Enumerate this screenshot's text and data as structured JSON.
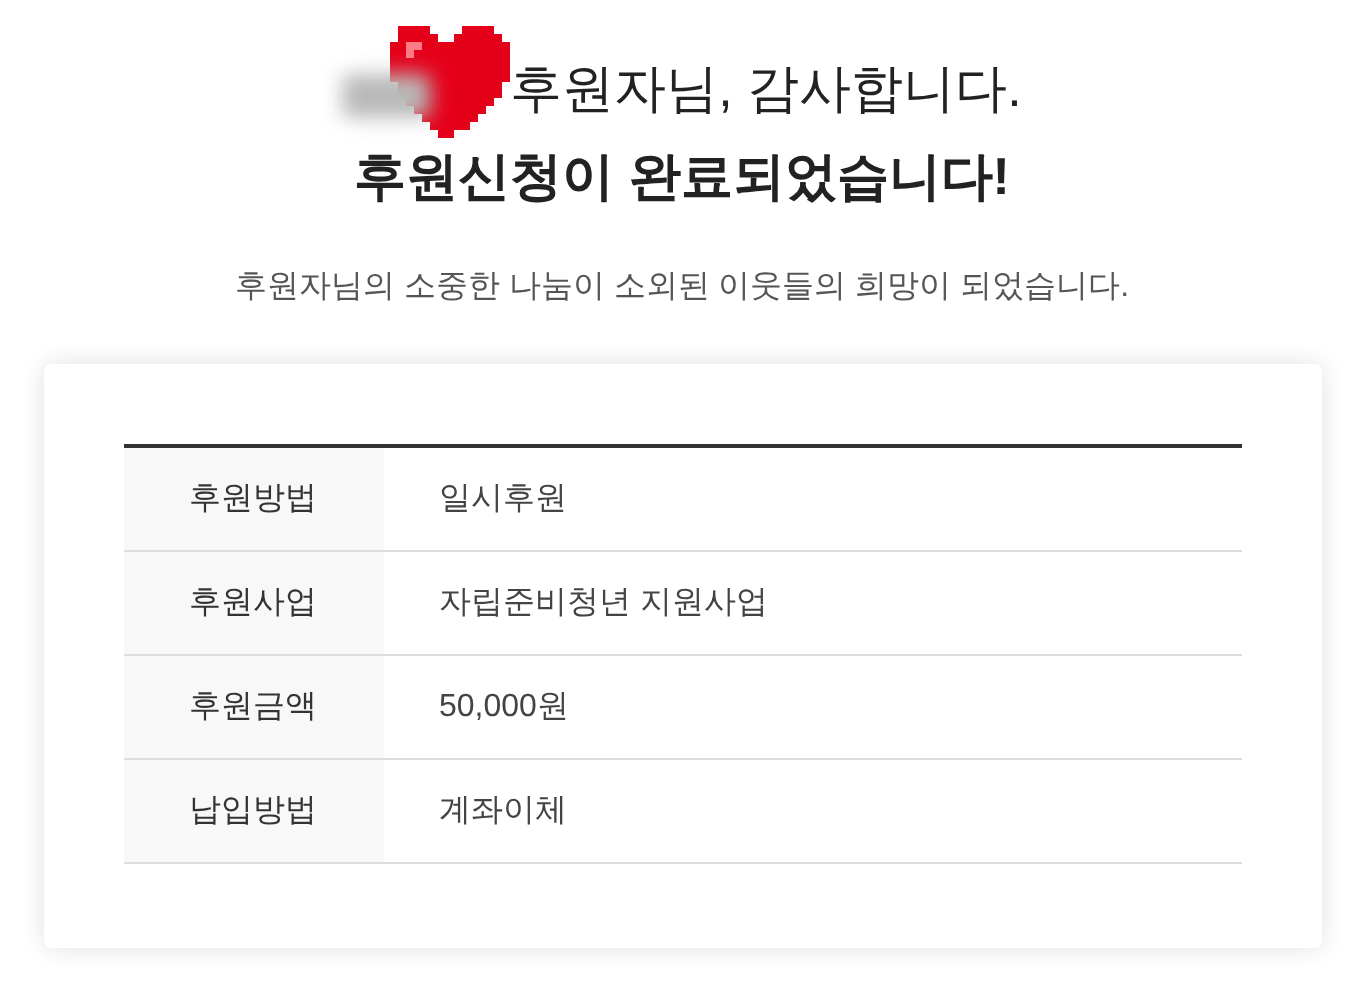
{
  "heading": {
    "greeting": "후원자님, 감사합니다.",
    "title": "후원신청이 완료되었습니다!"
  },
  "subtitle": "후원자님의 소중한 나눔이 소외된 이웃들의 희망이 되었습니다.",
  "details": [
    {
      "label": "후원방법",
      "value": "일시후원"
    },
    {
      "label": "후원사업",
      "value": "자립준비청년 지원사업"
    },
    {
      "label": "후원금액",
      "value": "50,000원"
    },
    {
      "label": "납입방법",
      "value": "계좌이체"
    }
  ]
}
